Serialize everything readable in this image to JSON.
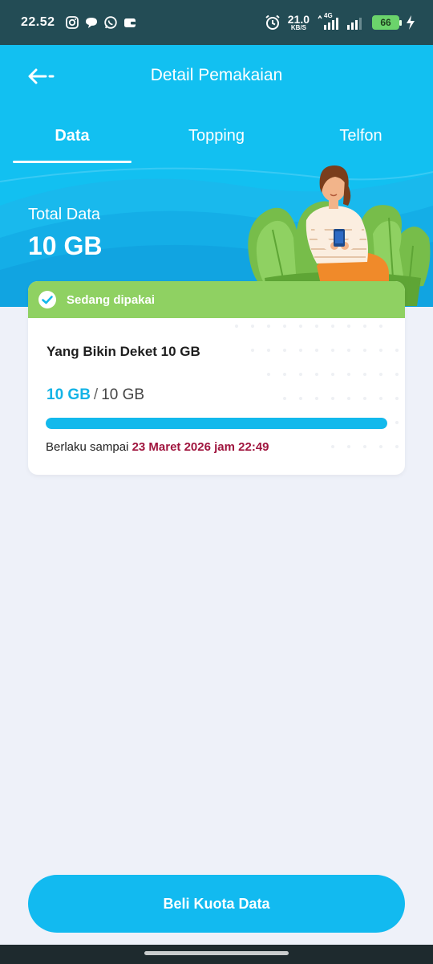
{
  "status_bar": {
    "time": "22.52",
    "net_speed": "21.0",
    "net_unit": "KB/S",
    "network_type": "4G",
    "battery": "66",
    "notification_icons": [
      "instagram-icon",
      "chat-bubble-icon",
      "whatsapp-icon",
      "wallet-icon"
    ]
  },
  "header": {
    "title": "Detail Pemakaian",
    "tabs": [
      {
        "label": "Data",
        "active": true
      },
      {
        "label": "Topping",
        "active": false
      },
      {
        "label": "Telfon",
        "active": false
      }
    ],
    "total_label": "Total Data",
    "total_value": "10 GB"
  },
  "card": {
    "badge": "Sedang dipakai",
    "package_name": "Yang Bikin Deket 10 GB",
    "remaining": "10 GB",
    "separator": "/",
    "total": "10 GB",
    "progress_fraction": 1.0,
    "valid_prefix": "Berlaku sampai",
    "valid_date": "23 Maret 2026 jam 22:49"
  },
  "buy_button": "Beli Kuota Data",
  "colors": {
    "primary": "#12c0f1",
    "badge_green": "#8fd162",
    "date_red": "#a0153e",
    "status_bar": "#234c55"
  }
}
